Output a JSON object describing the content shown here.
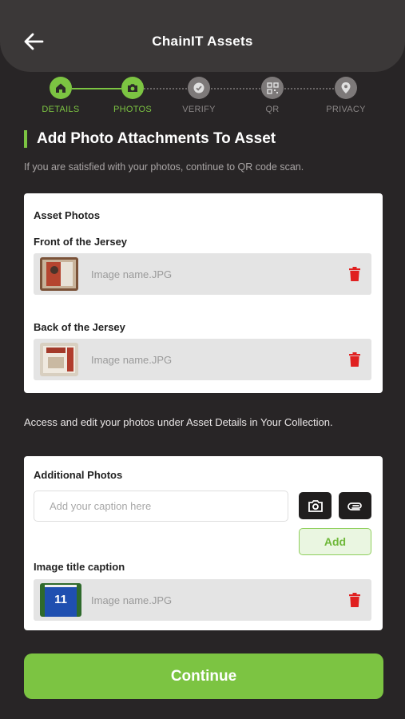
{
  "header": {
    "title": "ChainIT Assets",
    "back_icon": "arrow-left-icon"
  },
  "stepper": {
    "steps": [
      {
        "label": "DETAILS",
        "icon": "home-icon",
        "state": "active"
      },
      {
        "label": "PHOTOS",
        "icon": "camera-icon",
        "state": "active"
      },
      {
        "label": "VERIFY",
        "icon": "check-icon",
        "state": "inactive"
      },
      {
        "label": "QR",
        "icon": "qr-code-icon",
        "state": "inactive"
      },
      {
        "label": "PRIVACY",
        "icon": "location-pin-icon",
        "state": "inactive"
      }
    ]
  },
  "page": {
    "title": "Add Photo Attachments To Asset",
    "subtitle": "If you are satisfied with your photos, continue to QR code scan."
  },
  "asset_photos": {
    "heading": "Asset Photos",
    "front": {
      "label": "Front of the Jersey",
      "file_name": "Image name.JPG"
    },
    "back": {
      "label": "Back of the Jersey",
      "file_name": "Image name.JPG"
    }
  },
  "access_note": "Access and edit your photos under Asset Details in Your Collection.",
  "additional_photos": {
    "heading": "Additional Photos",
    "caption_placeholder": "Add your caption here",
    "add_label": "Add",
    "item": {
      "caption": "Image title caption",
      "file_name": "Image name.JPG",
      "jersey_number": "11"
    }
  },
  "continue_label": "Continue",
  "colors": {
    "accent": "#7cc442",
    "background": "#282526",
    "header": "#3b3838",
    "delete": "#e02020"
  }
}
